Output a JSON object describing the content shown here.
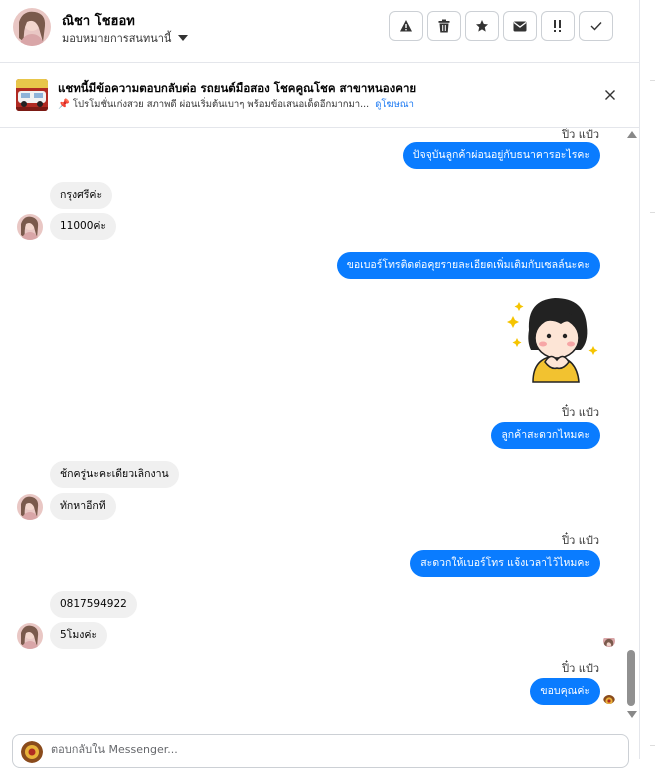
{
  "header": {
    "name": "ณิชา โชฮอท",
    "assign_label": "มอบหมายการสนทนานี้"
  },
  "ad": {
    "title": "แชทนี้มีข้อความตอบกลับต่อ รถยนต์มือสอง โชคคูณโชค สาขาหนองคาย",
    "subtitle": "📌 โปรโมชั่นเก่งสวย สภาพดี ผ่อนเริ่มต้นเบาๆ พร้อมข้อเสนอเด็ดอีกมากมา...",
    "link": "ดูโฆษณา"
  },
  "messages": {
    "sender_name": "ปิ๋ว แป๋ว",
    "out1": "ปัจจุบันลูกค้าผ่อนอยู่กับธนาคารอะไรคะ",
    "in1": "กรุงศรีค่ะ",
    "in2": "11000ค่ะ",
    "out2": "ขอเบอร์โทรติดต่อคุยรายละเอียดเพิ่มเติมกับเซลล์นะคะ",
    "out3": "ลูกค้าสะดวกไหมคะ",
    "in3": "ช้กครู่นะคะเดียวเลิกงาน",
    "in4": "ทักหาอีกที",
    "out4": "สะดวกให้เบอร์โทร แจ้งเวลาไว้ไหมคะ",
    "in5": "0817594922",
    "in6": "5โมงค่ะ",
    "out5": "ขอบคุณค่ะ"
  },
  "composer": {
    "placeholder": "ตอบกลับใน Messenger..."
  },
  "colors": {
    "accent": "#0a7cff",
    "incoming_bubble": "#f0f0f0"
  },
  "icons": [
    "warning-icon",
    "trash-icon",
    "star-icon",
    "envelope-icon",
    "urgent-icon",
    "check-icon",
    "close-icon",
    "pin-icon",
    "caret-down-icon"
  ]
}
